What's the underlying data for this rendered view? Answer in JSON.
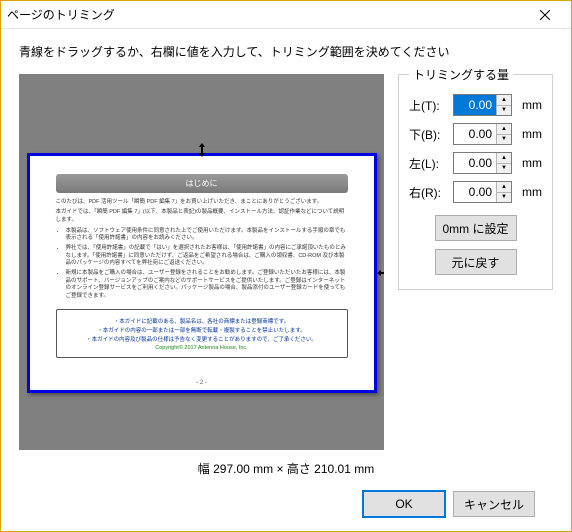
{
  "window": {
    "title": "ページのトリミング"
  },
  "instruction": "青線をドラッグするか、右欄に値を入力して、トリミング範囲を決めてください",
  "preview": {
    "page_header": "はじめに",
    "page_p1": "このたびは、PDF 活用ツール「瞬簡 PDF 編集 7」をお買い上げいただき、まことにありがとうございます。",
    "page_p2": "本ガイドでは、「瞬簡 PDF 編集 7」(以下、本製品と表記)の製品概要、インストール方法、認証作業などについて説明します。",
    "page_li1": "本製品は、ソフトウェア使用条件に同意された上でご使用いただけます。本製品をインストールする手順の章でも表示される「使用許諾書」の内容をお読みください。",
    "page_li2": "弊社では、「使用許諾書」の記載で「はい」を選択されたお客様は、「使用許諾書」の内容にご承諾頂いたものとみなします。「使用許諾書」に同意いただけず、ご返品をご希望される場合は、ご購入の領収書、CD-ROM 及び本製品のパッケージの内容すべてを弊社宛にご返送ください。",
    "page_li3": "新規に本製品をご購入の場合は、ユーザー登録をされることをお勧めします。ご登録いただいたお客様には、本製品のサポート、バージョンアップのご案内などのサポートサービスをご提供いたします。ご登録はインターネットのオンライン登録サービスをご利用ください。パッケージ製品の場合、製品添付のユーザー登録カードを使ってもご登録できます。",
    "page_box1": "・本ガイドに記載のある、製品名は、各社の商標または登録商標です。",
    "page_box2": "・本ガイドの内容の一部または一部を無断で転載・複製することを禁止いたします。",
    "page_box3": "・本ガイドの内容及び製品の仕様は予告なく変更することがありますので、ご了承ください。",
    "page_copyright": "Copyright© 2017 Antenna House, Inc.",
    "page_number": "- 2 -"
  },
  "trim_group": {
    "title": "トリミングする量",
    "top_label": "上(T):",
    "bottom_label": "下(B):",
    "left_label": "左(L):",
    "right_label": "右(R):",
    "unit": "mm",
    "values": {
      "top": "0.00",
      "bottom": "0.00",
      "left": "0.00",
      "right": "0.00"
    },
    "set_zero_label": "0mm に設定",
    "reset_label": "元に戻す"
  },
  "dimensions": "幅 297.00 mm × 高さ 210.01 mm",
  "footer": {
    "ok": "OK",
    "cancel": "キャンセル"
  }
}
